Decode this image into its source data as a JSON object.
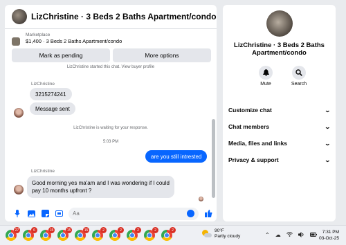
{
  "chat": {
    "title": "LizChristine · 3 Beds 2 Baths Apartment/condo",
    "info_icon": "i",
    "marketplace": {
      "label": "Marketplace",
      "listing": "$1,400 · 3 Beds 2 Baths Apartment/condo"
    },
    "buttons": {
      "mark_pending": "Mark as pending",
      "more_options": "More options"
    },
    "started_notice": "LizChristine started this chat. View buyer profile",
    "sender_name": "LizChristine",
    "messages_in_1": [
      "3215274241",
      "Message sent"
    ],
    "waiting_notice": "LizChristine is waiting for your response.",
    "timestamp": "5:03 PM",
    "message_out": "are you still intrested",
    "sender_name_2": "LizChristine",
    "message_in_2_line1": "Good morning yes ma'am and I was wondering if I could",
    "message_in_2_line2": "pay 10 months upfront ?",
    "composer_placeholder": "Aa"
  },
  "info_panel": {
    "title_line1": "LizChristine · 3 Beds 2 Baths",
    "title_line2": "Apartment/condo",
    "actions": [
      {
        "label": "Mute",
        "icon": "bell-icon"
      },
      {
        "label": "Search",
        "icon": "search-icon"
      }
    ],
    "menu": [
      "Customize chat",
      "Chat members",
      "Media, files and links",
      "Privacy & support"
    ]
  },
  "taskbar": {
    "badges": [
      "27",
      "6",
      "15",
      "15",
      "15",
      "2",
      "2",
      "2",
      "2",
      "2"
    ],
    "weather_temp": "90°F",
    "weather_desc": "Partly cloudy",
    "time": "7:31 PM",
    "date": "03-Oct-25"
  },
  "colors": {
    "accent": "#0866ff",
    "info_icon": "#a033e8",
    "bubble_in": "#e4e6eb"
  }
}
